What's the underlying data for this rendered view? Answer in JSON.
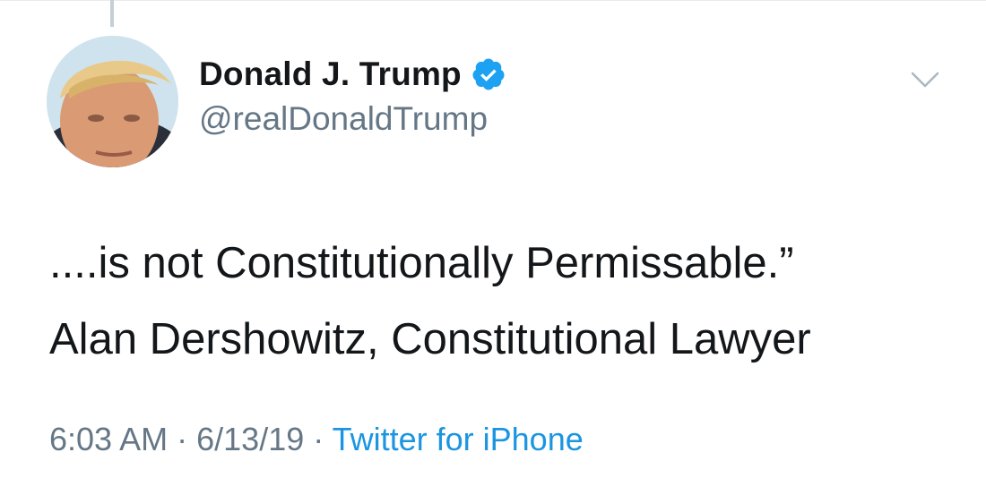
{
  "user": {
    "display_name": "Donald J. Trump",
    "handle": "@realDonaldTrump",
    "verified": true
  },
  "tweet": {
    "lines": [
      "....is not Constitutionally Permissable.”",
      "Alan Dershowitz, Constitutional Lawyer"
    ]
  },
  "meta": {
    "time": "6:03 AM",
    "separator": "·",
    "date": "6/13/19",
    "source": "Twitter for iPhone"
  },
  "icons": {
    "verified": "verified-badge-icon",
    "menu": "chevron-down-icon"
  },
  "colors": {
    "text": "#14171a",
    "secondary": "#657786",
    "link": "#1b95e0",
    "verified": "#1da1f2"
  }
}
